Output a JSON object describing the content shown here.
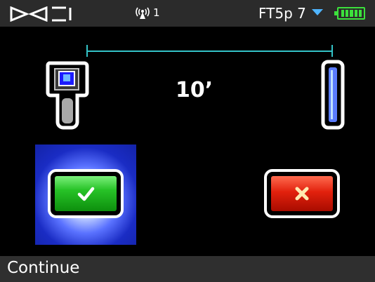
{
  "statusbar": {
    "brand_logo": "DCI",
    "signal_icon": "antenna-icon",
    "signal_channel": "1",
    "frequency_label": "FT5p 7",
    "dropdown_icon": "triangle-down-icon",
    "battery_icon": "battery-full-icon"
  },
  "main": {
    "distance_value": "10’",
    "left_device_icon": "locator-icon",
    "right_device_icon": "transmitter-icon",
    "dimension_icon": "distance-dimension-line",
    "accept_icon": "checkmark-icon",
    "reject_icon": "x-icon"
  },
  "footer": {
    "label": "Continue"
  },
  "colors": {
    "dimension_line": "#34c3c7",
    "battery": "#3ce13c",
    "accept_button": "#27c227",
    "reject_button": "#e2210d",
    "selection_highlight": "#1a2cc4",
    "status_bar": "#2b2b2b",
    "footer_bar": "#2f2f2f"
  }
}
